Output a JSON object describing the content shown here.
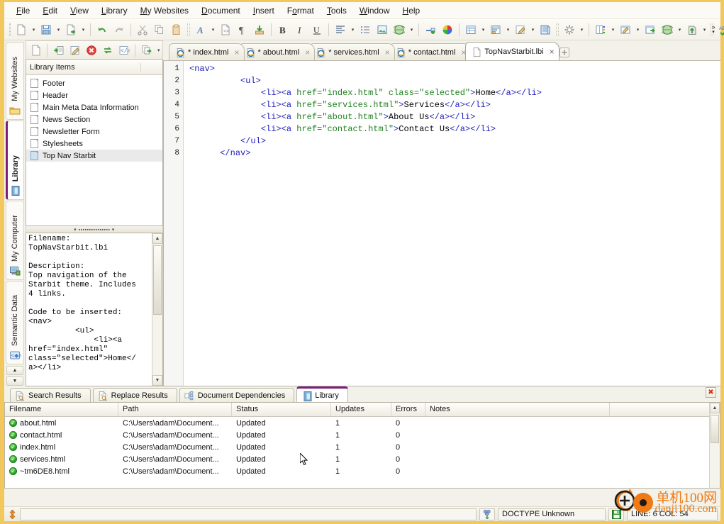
{
  "menu": {
    "items": [
      {
        "label": "File",
        "accel": "F"
      },
      {
        "label": "Edit",
        "accel": "E"
      },
      {
        "label": "View",
        "accel": "V"
      },
      {
        "label": "Library",
        "accel": "L"
      },
      {
        "label": "My Websites",
        "accel": "M"
      },
      {
        "label": "Document",
        "accel": "D"
      },
      {
        "label": "Insert",
        "accel": "I"
      },
      {
        "label": "Format",
        "accel": "o"
      },
      {
        "label": "Tools",
        "accel": "T"
      },
      {
        "label": "Window",
        "accel": "W"
      },
      {
        "label": "Help",
        "accel": "H"
      }
    ]
  },
  "toolbar": {
    "overflow_label": "»",
    "buttons": [
      {
        "name": "new-document-icon",
        "has_arrow": true
      },
      {
        "name": "save-icon",
        "has_arrow": true
      },
      {
        "name": "publish-icon",
        "has_arrow": true
      },
      {
        "name": "undo-icon",
        "has_arrow": false
      },
      {
        "name": "redo-icon",
        "has_arrow": false
      },
      {
        "name": "cut-icon",
        "has_arrow": false
      },
      {
        "name": "copy-icon",
        "has_arrow": false
      },
      {
        "name": "paste-icon",
        "has_arrow": false
      },
      {
        "name": "font-icon",
        "has_arrow": true
      },
      {
        "name": "code-preview-icon",
        "has_arrow": false
      },
      {
        "name": "paragraph-mark-icon",
        "has_arrow": false
      },
      {
        "name": "insert-download-icon",
        "has_arrow": false
      },
      {
        "name": "bold-icon",
        "has_arrow": false
      },
      {
        "name": "italic-icon",
        "has_arrow": false
      },
      {
        "name": "underline-icon",
        "has_arrow": false
      },
      {
        "name": "align-icon",
        "has_arrow": true
      },
      {
        "name": "bullet-list-icon",
        "has_arrow": false
      },
      {
        "name": "insert-image-icon",
        "has_arrow": false
      },
      {
        "name": "insert-media-icon",
        "has_arrow": true
      },
      {
        "name": "insert-hyperlink-icon",
        "has_arrow": false
      },
      {
        "name": "color-picker-icon",
        "has_arrow": false
      },
      {
        "name": "insert-table-icon",
        "has_arrow": true
      },
      {
        "name": "insert-form-icon",
        "has_arrow": true
      },
      {
        "name": "edit-style-icon",
        "has_arrow": true
      },
      {
        "name": "layers-icon",
        "has_arrow": false
      },
      {
        "name": "settings-icon",
        "has_arrow": true
      },
      {
        "name": "filmstrip-icon",
        "has_arrow": true
      },
      {
        "name": "design-view-icon",
        "has_arrow": true
      },
      {
        "name": "export-icon",
        "has_arrow": false
      },
      {
        "name": "preview-browser-icon",
        "has_arrow": true
      },
      {
        "name": "upload-icon",
        "has_arrow": true
      },
      {
        "name": "spellcheck-icon",
        "has_arrow": true
      },
      {
        "name": "search-icon",
        "has_arrow": true
      }
    ]
  },
  "vertical_tabs": {
    "items": [
      {
        "label": "My Websites",
        "icon": "folder-icon",
        "active": false
      },
      {
        "label": "Library",
        "icon": "library-book-icon",
        "active": true
      },
      {
        "label": "My Computer",
        "icon": "computer-icon",
        "active": false
      },
      {
        "label": "Semantic Data",
        "icon": "semantic-code-icon",
        "active": false
      }
    ],
    "scroll_up": "▲",
    "scroll_down": "▼"
  },
  "library_panel": {
    "toolbar_buttons": [
      {
        "name": "new-library-item-icon"
      },
      {
        "name": "insert-library-item-icon"
      },
      {
        "name": "edit-library-item-icon"
      },
      {
        "name": "delete-library-item-icon"
      },
      {
        "name": "refresh-library-icon"
      },
      {
        "name": "view-code-icon"
      },
      {
        "name": "export-library-icon"
      }
    ],
    "header": "Library Items",
    "items": [
      {
        "label": "Footer",
        "selected": false
      },
      {
        "label": "Header",
        "selected": false
      },
      {
        "label": "Main Meta Data Information",
        "selected": false
      },
      {
        "label": "News Section",
        "selected": false
      },
      {
        "label": "Newsletter Form",
        "selected": false
      },
      {
        "label": "Stylesheets",
        "selected": false
      },
      {
        "label": "Top Nav Starbit",
        "selected": true
      }
    ],
    "description_text": "Filename:\nTopNavStarbit.lbi\n\nDescription:\nTop navigation of the\nStarbit theme. Includes\n4 links.\n\nCode to be inserted:\n<nav>\n          <ul>\n              <li><a\nhref=\"index.html\"\nclass=\"selected\">Home</\na></li>"
  },
  "document_tabs": {
    "items": [
      {
        "label": "* index.html",
        "icon": "ie-document-icon",
        "active": false,
        "close": "×"
      },
      {
        "label": "* about.html",
        "icon": "ie-document-icon",
        "active": false,
        "close": "×"
      },
      {
        "label": "* services.html",
        "icon": "ie-document-icon",
        "active": false,
        "close": "×"
      },
      {
        "label": "* contact.html",
        "icon": "ie-document-icon",
        "active": false,
        "close": "×"
      },
      {
        "label": "TopNavStarbit.lbi",
        "icon": "lbi-document-icon",
        "active": true,
        "close": "×"
      }
    ],
    "new_tab_label": "+"
  },
  "editor": {
    "line_numbers": [
      "1",
      "2",
      "3",
      "4",
      "5",
      "6",
      "7",
      "8"
    ],
    "lines": [
      [
        {
          "t": "tg",
          "s": "<nav>"
        }
      ],
      [
        {
          "t": "tx",
          "s": "          "
        },
        {
          "t": "tg",
          "s": "<ul>"
        }
      ],
      [
        {
          "t": "tx",
          "s": "              "
        },
        {
          "t": "tg",
          "s": "<li><a "
        },
        {
          "t": "at",
          "s": "href="
        },
        {
          "t": "va",
          "s": "\"index.html\""
        },
        {
          "t": "tg",
          "s": " "
        },
        {
          "t": "at",
          "s": "class="
        },
        {
          "t": "va",
          "s": "\"selected\""
        },
        {
          "t": "tg",
          "s": ">"
        },
        {
          "t": "tx",
          "s": "Home"
        },
        {
          "t": "tg",
          "s": "</a></li>"
        }
      ],
      [
        {
          "t": "tx",
          "s": "              "
        },
        {
          "t": "tg",
          "s": "<li><a "
        },
        {
          "t": "at",
          "s": "href="
        },
        {
          "t": "va",
          "s": "\"services.html\""
        },
        {
          "t": "tg",
          "s": ">"
        },
        {
          "t": "tx",
          "s": "Services"
        },
        {
          "t": "tg",
          "s": "</a></li>"
        }
      ],
      [
        {
          "t": "tx",
          "s": "              "
        },
        {
          "t": "tg",
          "s": "<li><a "
        },
        {
          "t": "at",
          "s": "href="
        },
        {
          "t": "va",
          "s": "\"about.html\""
        },
        {
          "t": "tg",
          "s": ">"
        },
        {
          "t": "tx",
          "s": "About Us"
        },
        {
          "t": "tg",
          "s": "</a></li>"
        }
      ],
      [
        {
          "t": "tx",
          "s": "              "
        },
        {
          "t": "tg",
          "s": "<li><a "
        },
        {
          "t": "at",
          "s": "href="
        },
        {
          "t": "va",
          "s": "\"contact.html\""
        },
        {
          "t": "tg",
          "s": ">"
        },
        {
          "t": "tx",
          "s": "Contact Us"
        },
        {
          "t": "tg",
          "s": "</a></li>"
        }
      ],
      [
        {
          "t": "tx",
          "s": "          "
        },
        {
          "t": "tg",
          "s": "</ul>"
        }
      ],
      [
        {
          "t": "tx",
          "s": "      "
        },
        {
          "t": "tg",
          "s": "</nav>"
        }
      ]
    ]
  },
  "bottom_panel": {
    "tabs": [
      {
        "label": "Search Results",
        "icon": "search-results-icon",
        "active": false
      },
      {
        "label": "Replace Results",
        "icon": "replace-results-icon",
        "active": false
      },
      {
        "label": "Document Dependencies",
        "icon": "dependencies-icon",
        "active": false
      },
      {
        "label": "Library",
        "icon": "library-book-icon",
        "active": true
      }
    ],
    "close_label": "✖",
    "columns": [
      "Filename",
      "Path",
      "Status",
      "Updates",
      "Errors",
      "Notes"
    ],
    "rows": [
      {
        "filename": "about.html",
        "path": "C:\\Users\\adam\\Document...",
        "status": "Updated",
        "updates": "1",
        "errors": "0",
        "notes": ""
      },
      {
        "filename": "contact.html",
        "path": "C:\\Users\\adam\\Document...",
        "status": "Updated",
        "updates": "1",
        "errors": "0",
        "notes": ""
      },
      {
        "filename": "index.html",
        "path": "C:\\Users\\adam\\Document...",
        "status": "Updated",
        "updates": "1",
        "errors": "0",
        "notes": ""
      },
      {
        "filename": "services.html",
        "path": "C:\\Users\\adam\\Document...",
        "status": "Updated",
        "updates": "1",
        "errors": "0",
        "notes": ""
      },
      {
        "filename": "~tm6DE8.html",
        "path": "C:\\Users\\adam\\Document...",
        "status": "Updated",
        "updates": "1",
        "errors": "0",
        "notes": ""
      }
    ],
    "scroll_up": "▲"
  },
  "statusbar": {
    "message": "",
    "doctype": "DOCTYPE Unknown",
    "position": "LINE: 6  COL: 54",
    "encoding_icon": "encoding-icon",
    "save-state-icon": "save-state-icon"
  },
  "watermark": {
    "line1": "单机100网",
    "line2": "danji100.com"
  },
  "colors": {
    "window_border": "#f2c75c",
    "active_tab_accent": "#7b1f7b",
    "tag": "#2020c0",
    "attr": "#208020",
    "status_ok": "#22a021"
  }
}
